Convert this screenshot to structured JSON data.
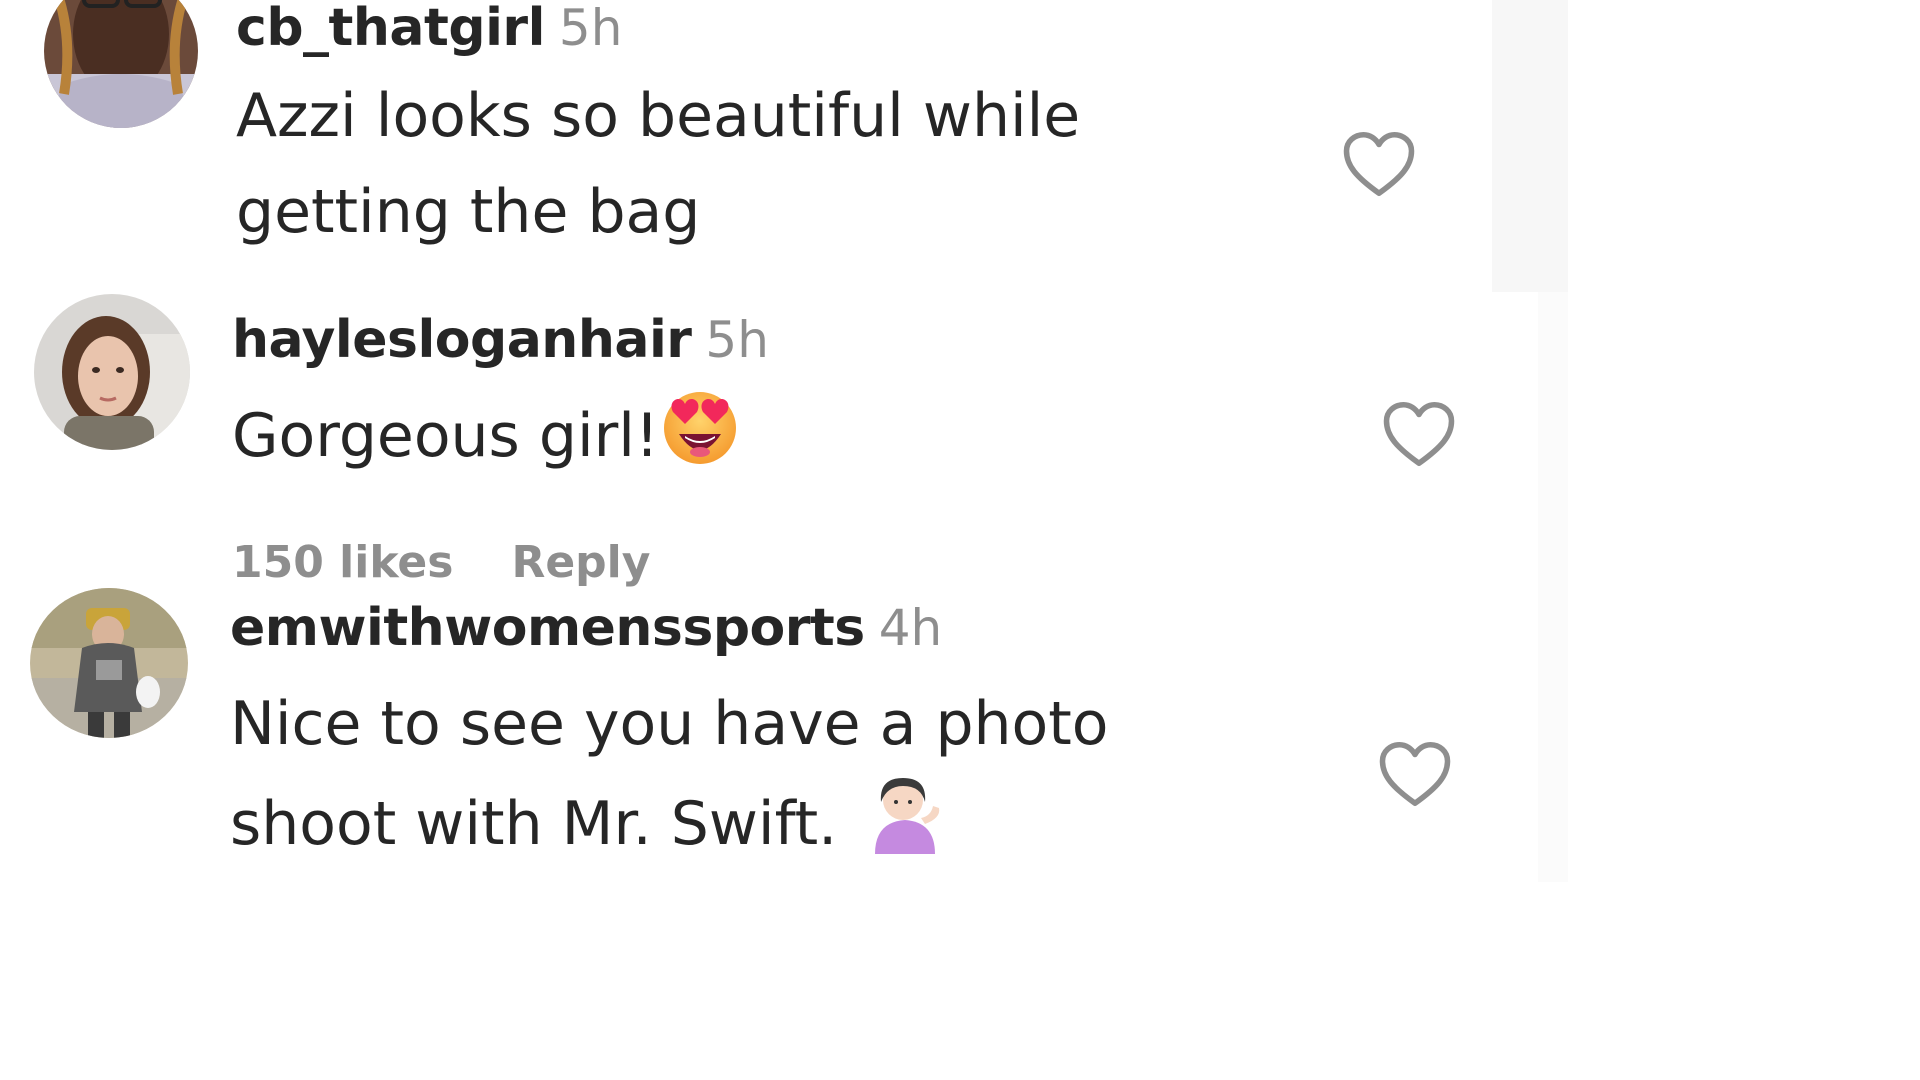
{
  "comments": [
    {
      "username": "cb_thatgirl",
      "time": "5h",
      "text_line1": "Azzi looks so beautiful while",
      "text_line2": "getting the bag",
      "like_icon": "heart-outline-icon"
    },
    {
      "username": "haylesloganhair",
      "time": "5h",
      "text": "Gorgeous girl!",
      "emoji": "heart-eyes-emoji",
      "likes": "150 likes",
      "reply": "Reply",
      "like_icon": "heart-outline-icon"
    },
    {
      "username": "emwithwomenssports",
      "time": "4h",
      "text_line1": "Nice to see you have a photo",
      "text_line2": "shoot with Mr. Swift.",
      "emoji": "person-tipping-hand-emoji",
      "like_icon": "heart-outline-icon"
    }
  ],
  "colors": {
    "text": "#262626",
    "secondary": "#8e8e8e",
    "background": "#ffffff"
  }
}
